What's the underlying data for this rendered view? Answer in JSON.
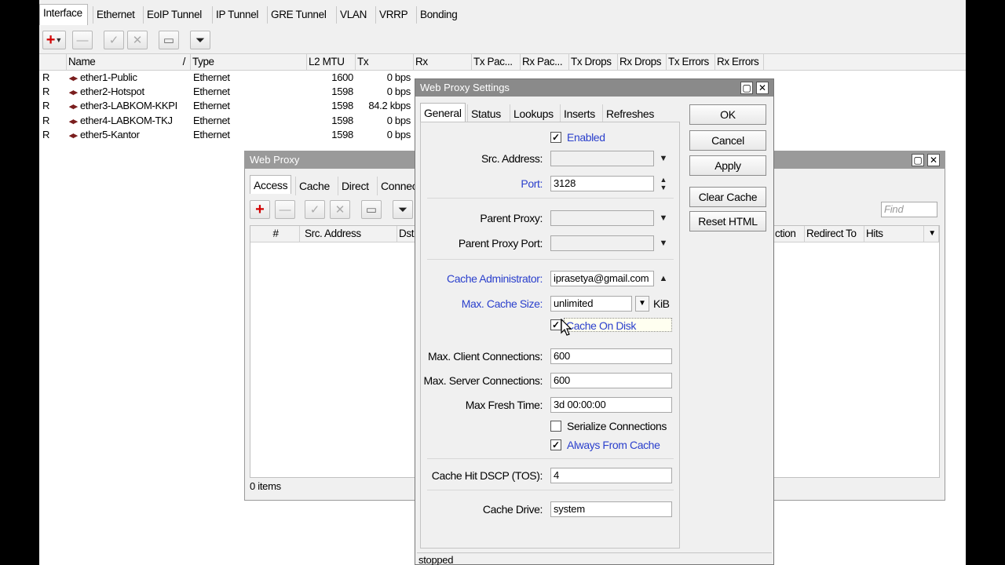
{
  "top_tabs": [
    "Interface",
    "Ethernet",
    "EoIP Tunnel",
    "IP Tunnel",
    "GRE Tunnel",
    "VLAN",
    "VRRP",
    "Bonding"
  ],
  "columns": [
    "Name",
    "Type",
    "L2 MTU",
    "Tx",
    "Rx",
    "Tx Pac...",
    "Rx Pac...",
    "Tx Drops",
    "Rx Drops",
    "Tx Errors",
    "Rx Errors"
  ],
  "sort_indicator": "/",
  "interfaces": [
    {
      "flag": "R",
      "name": "ether1-Public",
      "type": "Ethernet",
      "mtu": "1600",
      "tx": "0 bps"
    },
    {
      "flag": "R",
      "name": "ether2-Hotspot",
      "type": "Ethernet",
      "mtu": "1598",
      "tx": "0 bps"
    },
    {
      "flag": "R",
      "name": "ether3-LABKOM-KKPI",
      "type": "Ethernet",
      "mtu": "1598",
      "tx": "84.2 kbps"
    },
    {
      "flag": "R",
      "name": "ether4-LABKOM-TKJ",
      "type": "Ethernet",
      "mtu": "1598",
      "tx": "0 bps"
    },
    {
      "flag": "R",
      "name": "ether5-Kantor",
      "type": "Ethernet",
      "mtu": "1598",
      "tx": "0 bps"
    }
  ],
  "web_proxy": {
    "title": "Web Proxy",
    "tabs": [
      "Access",
      "Cache",
      "Direct",
      "Connec"
    ],
    "columns": [
      "#",
      "Src. Address",
      "Dst",
      "ction",
      "Redirect To",
      "Hits"
    ],
    "find_placeholder": "Find",
    "status": "0 items"
  },
  "settings": {
    "title": "Web Proxy Settings",
    "tabs": [
      "General",
      "Status",
      "Lookups",
      "Inserts",
      "Refreshes"
    ],
    "enabled_label": "Enabled",
    "src_address_label": "Src. Address:",
    "src_address_value": "",
    "port_label": "Port:",
    "port_value": "3128",
    "parent_proxy_label": "Parent Proxy:",
    "parent_proxy_port_label": "Parent Proxy Port:",
    "cache_admin_label": "Cache Administrator:",
    "cache_admin_value": "iprasetya@gmail.com",
    "max_cache_size_label": "Max. Cache Size:",
    "max_cache_size_value": "unlimited",
    "max_cache_size_unit": "KiB",
    "cache_on_disk_label": "Cache On Disk",
    "max_client_label": "Max. Client Connections:",
    "max_client_value": "600",
    "max_server_label": "Max. Server Connections:",
    "max_server_value": "600",
    "max_fresh_label": "Max Fresh Time:",
    "max_fresh_value": "3d 00:00:00",
    "serialize_label": "Serialize Connections",
    "always_cache_label": "Always From Cache",
    "dscp_label": "Cache Hit DSCP (TOS):",
    "dscp_value": "4",
    "drive_label": "Cache Drive:",
    "drive_value": "system",
    "buttons": {
      "ok": "OK",
      "cancel": "Cancel",
      "apply": "Apply",
      "clear_cache": "Clear Cache",
      "reset_html": "Reset HTML"
    },
    "status": "stopped",
    "checks": {
      "enabled": true,
      "cache_on_disk": true,
      "serialize": false,
      "always_from_cache": true
    }
  },
  "colors": {
    "accent_label": "#2a3fcc",
    "title_bar": "#8a8a8a",
    "add_icon": "#d10000"
  }
}
